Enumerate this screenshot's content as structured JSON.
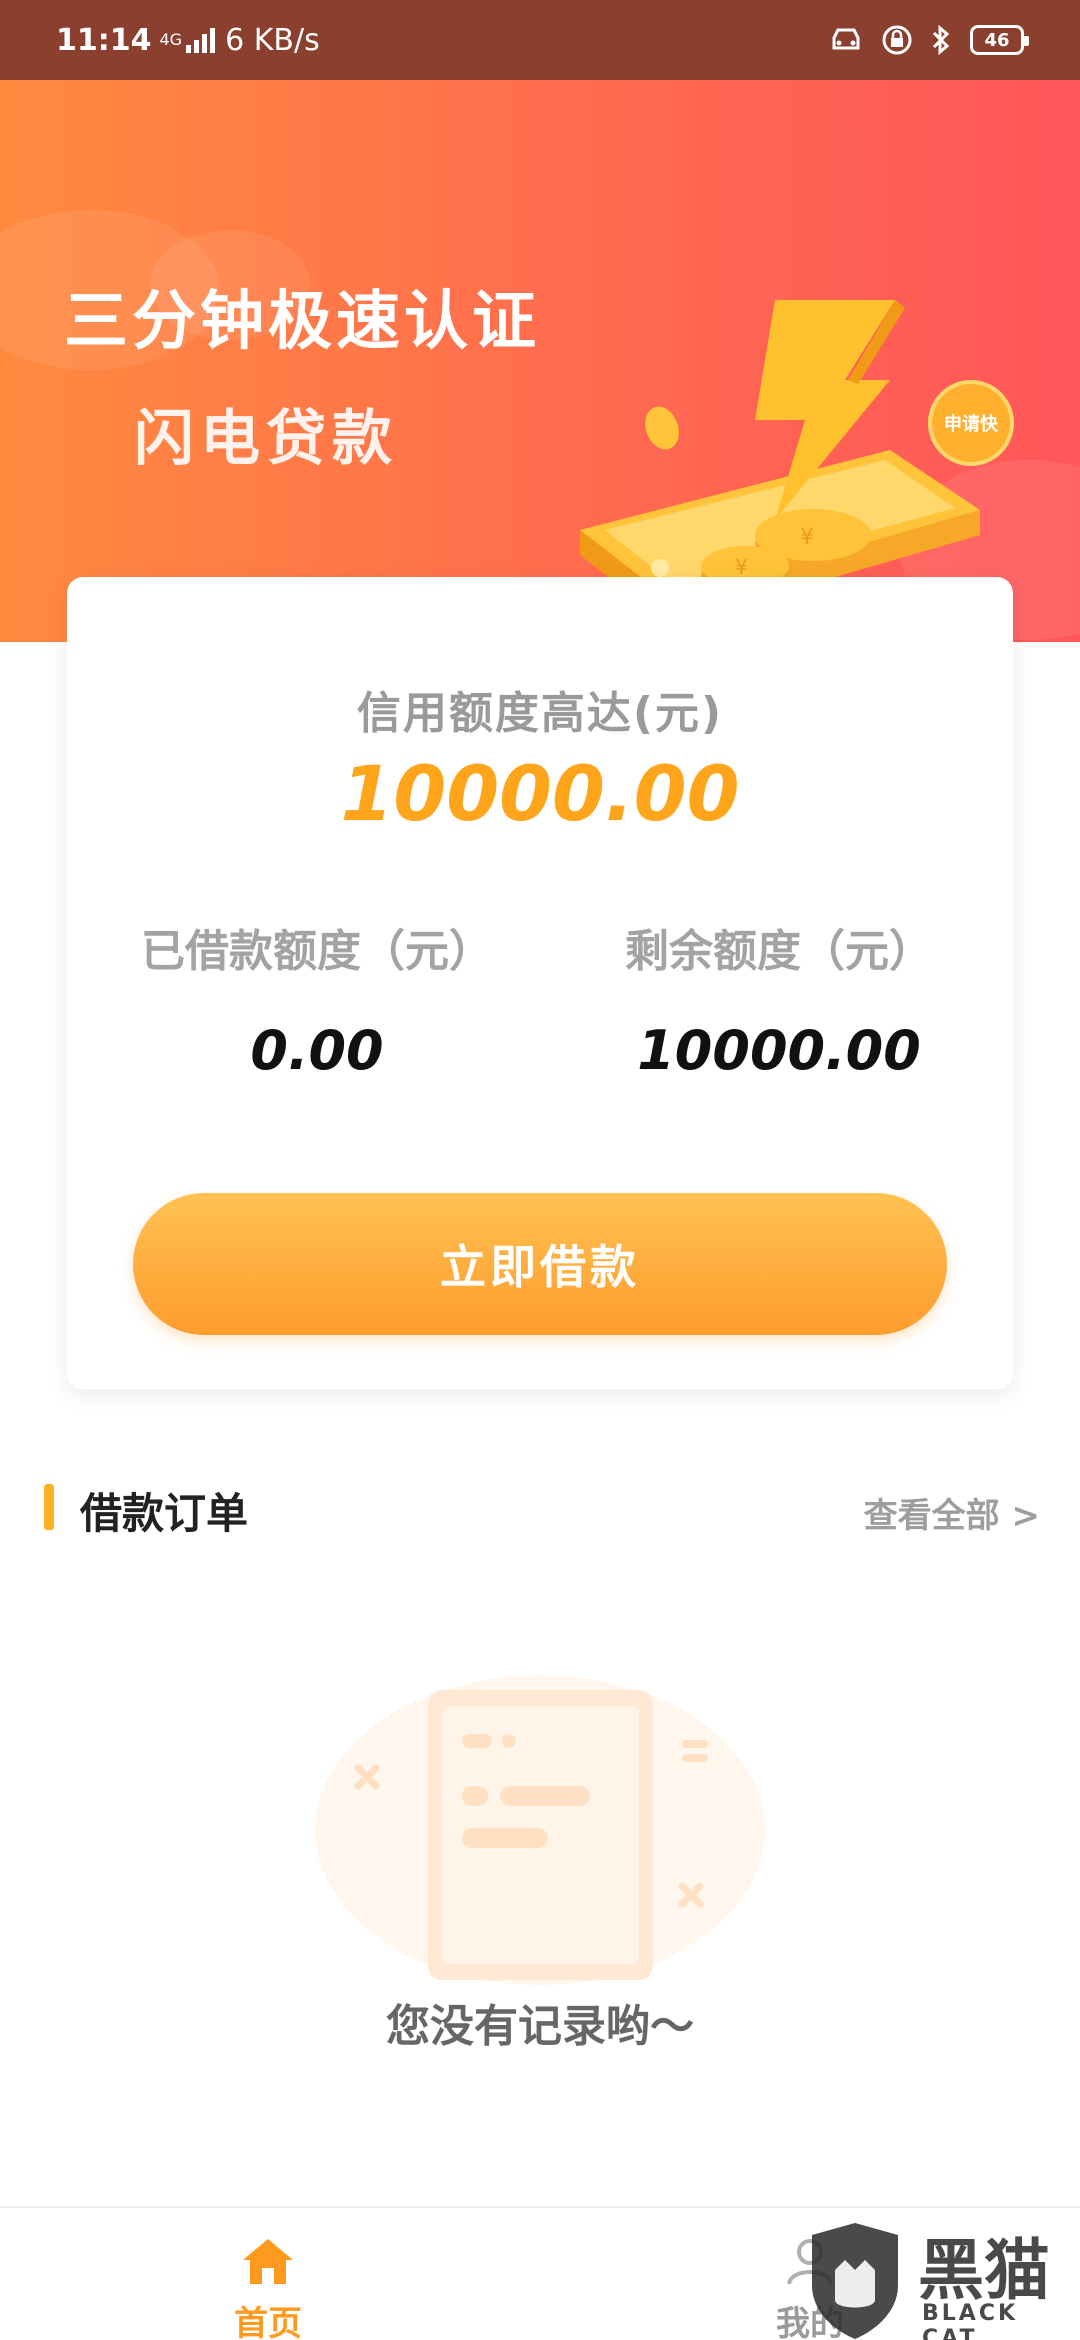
{
  "status_bar": {
    "time": "11:14",
    "network": "4G",
    "speed": "6 KB/s",
    "battery": "46",
    "icons": [
      "car-icon",
      "lock-icon",
      "bluetooth-icon",
      "battery-icon"
    ]
  },
  "hero": {
    "title": "三分钟极速认证",
    "subtitle": "闪电贷款",
    "badge": "申请快"
  },
  "credit": {
    "label": "信用额度高达(元)",
    "amount": "10000.00",
    "borrowed_label": "已借款额度（元）",
    "borrowed_value": "0.00",
    "remaining_label": "剩余额度（元）",
    "remaining_value": "10000.00",
    "borrow_button": "立即借款"
  },
  "orders": {
    "title": "借款订单",
    "view_all": "查看全部 >",
    "empty_text": "您没有记录哟～"
  },
  "tabbar": {
    "home_label": "首页",
    "mine_label": "我的"
  },
  "watermark": {
    "cn": "黑猫",
    "en": "BLACK CAT"
  },
  "colors": {
    "accent": "#ffa51c",
    "hero_start": "#ff8a3f",
    "hero_end": "#ff565a",
    "status_bar": "#8b3f2f"
  }
}
